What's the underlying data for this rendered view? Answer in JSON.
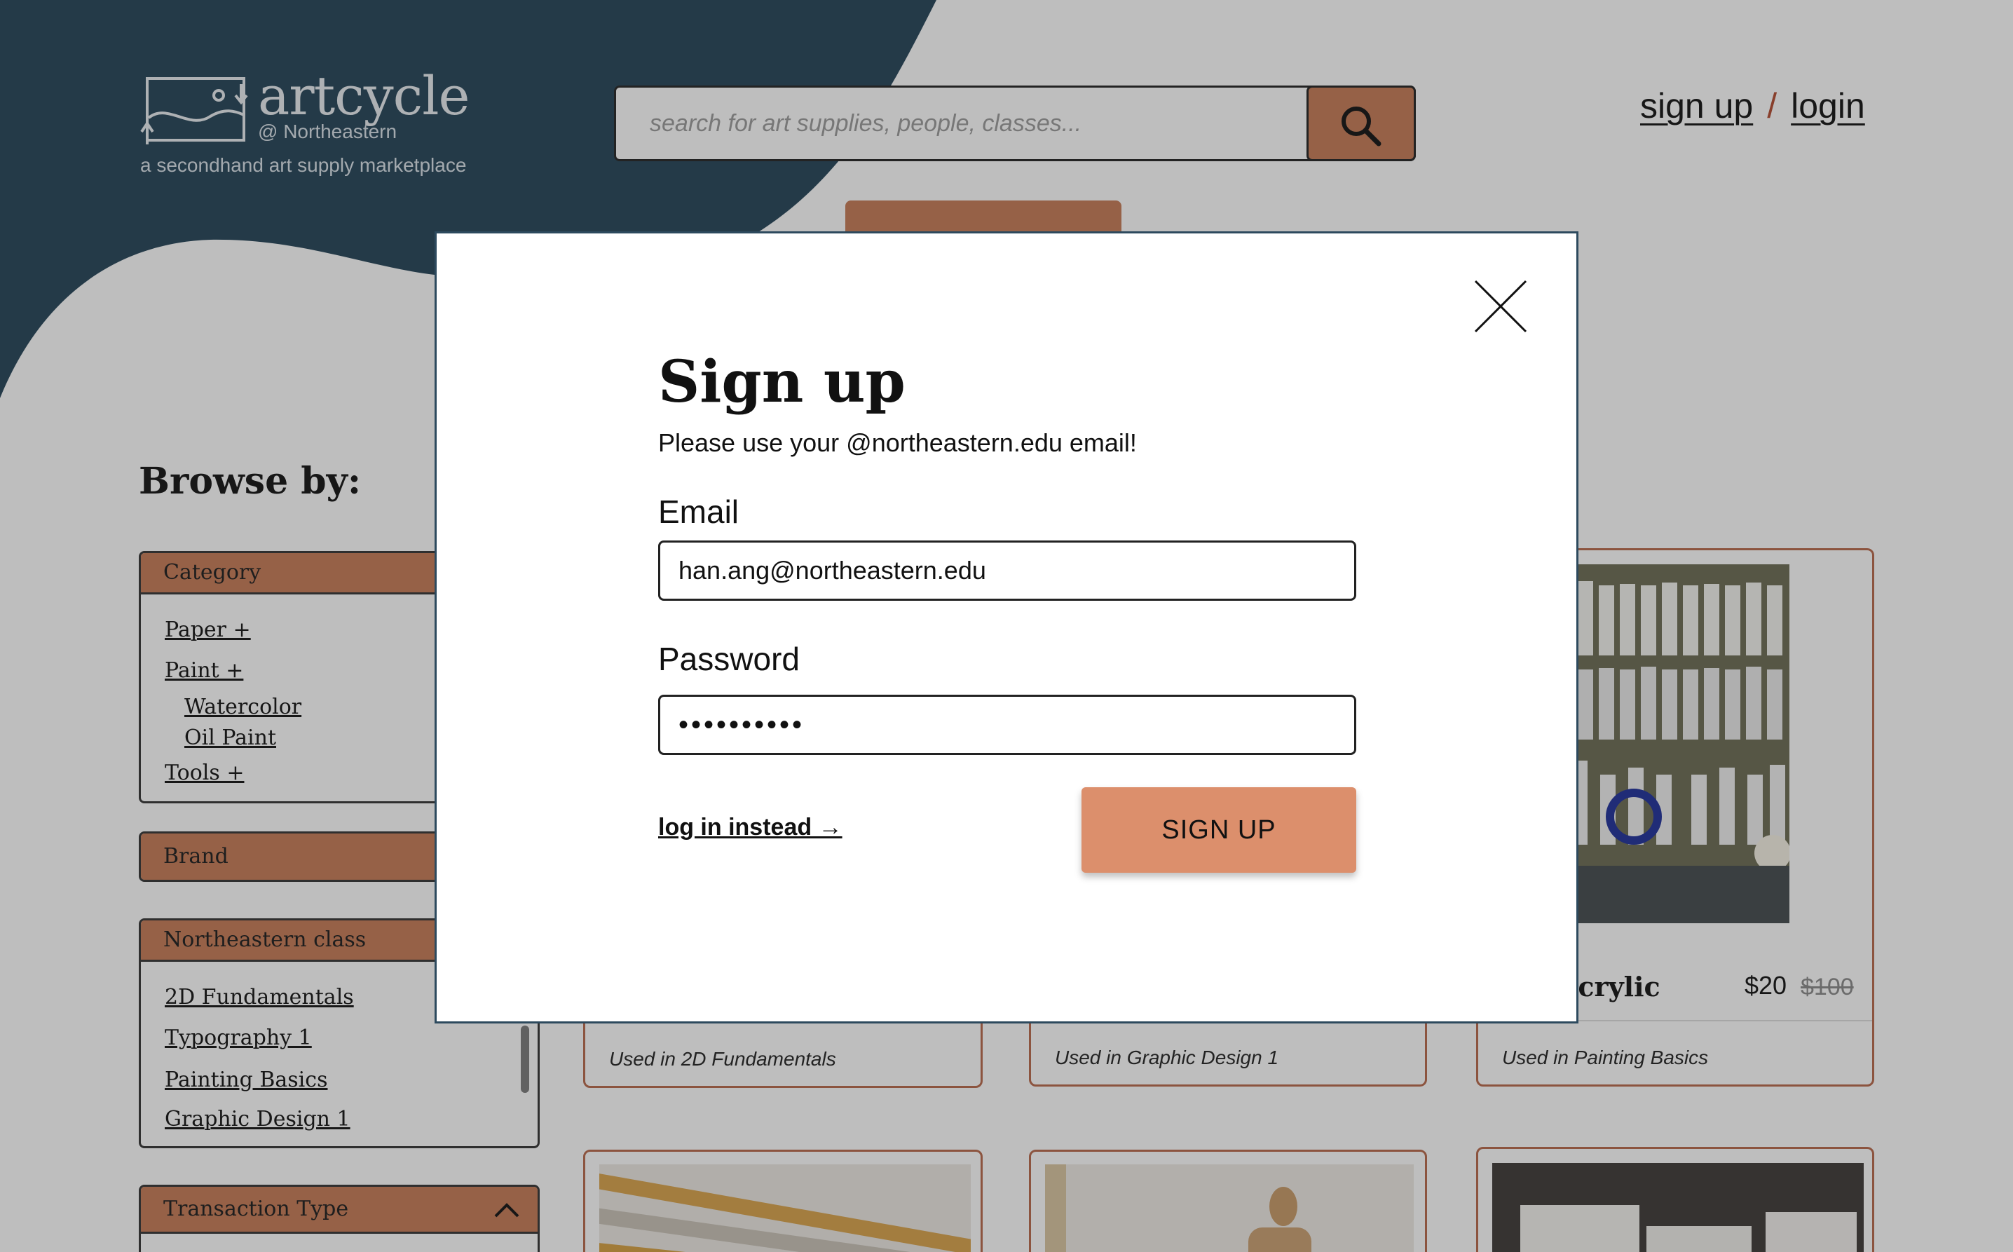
{
  "brand": {
    "name": "artcycle",
    "school": "@ Northeastern",
    "tagline": "a secondhand art supply marketplace"
  },
  "search": {
    "placeholder": "search for art supplies, people, classes..."
  },
  "auth": {
    "signup_label": "sign up",
    "separator": "/",
    "login_label": "login"
  },
  "sidebar": {
    "heading": "Browse by:",
    "category": {
      "title": "Category",
      "items": [
        "Paper +",
        "Paint +",
        "Watercolor",
        "Oil Paint",
        "Tools +"
      ]
    },
    "brand": {
      "title": "Brand"
    },
    "class": {
      "title": "Northeastern class",
      "items": [
        "2D Fundamentals",
        "Typography 1",
        "Painting Basics",
        "Graphic Design 1"
      ]
    },
    "transaction": {
      "title": "Transaction Type"
    }
  },
  "cards": [
    {
      "used_in": "Used in 2D Fundamentals"
    },
    {
      "used_in": "Used in Graphic Design 1"
    },
    {
      "title_partial": "EN Acrylic",
      "price": "$20",
      "old_price": "$100",
      "used_in": "Used in Painting Basics"
    }
  ],
  "modal": {
    "title": "Sign up",
    "subtitle": "Please use your @northeastern.edu email!",
    "email_label": "Email",
    "email_value": "han.ang@northeastern.edu",
    "password_label": "Password",
    "password_value": "••••••••••",
    "login_link": "log in instead →",
    "submit_label": "SIGN UP"
  },
  "colors": {
    "navy": "#234256",
    "accent": "#c67a55",
    "button": "#dc8f6c",
    "strike": "#888888"
  }
}
